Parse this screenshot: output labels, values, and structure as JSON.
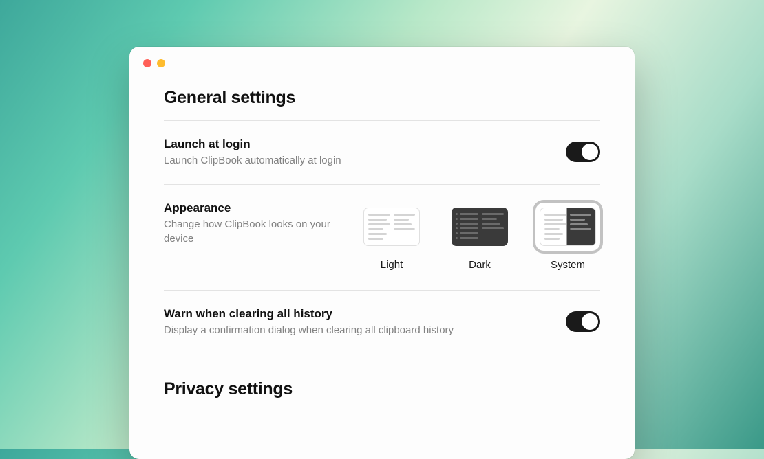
{
  "general": {
    "title": "General settings",
    "launch": {
      "title": "Launch at login",
      "desc": "Launch ClipBook automatically at login",
      "enabled": true
    },
    "appearance": {
      "title": "Appearance",
      "desc": "Change how ClipBook looks on your device",
      "options": {
        "light": "Light",
        "dark": "Dark",
        "system": "System"
      },
      "selected": "system"
    },
    "warn": {
      "title": "Warn when clearing all history",
      "desc": "Display a confirmation dialog when clearing all clipboard history",
      "enabled": true
    }
  },
  "privacy": {
    "title": "Privacy settings"
  }
}
